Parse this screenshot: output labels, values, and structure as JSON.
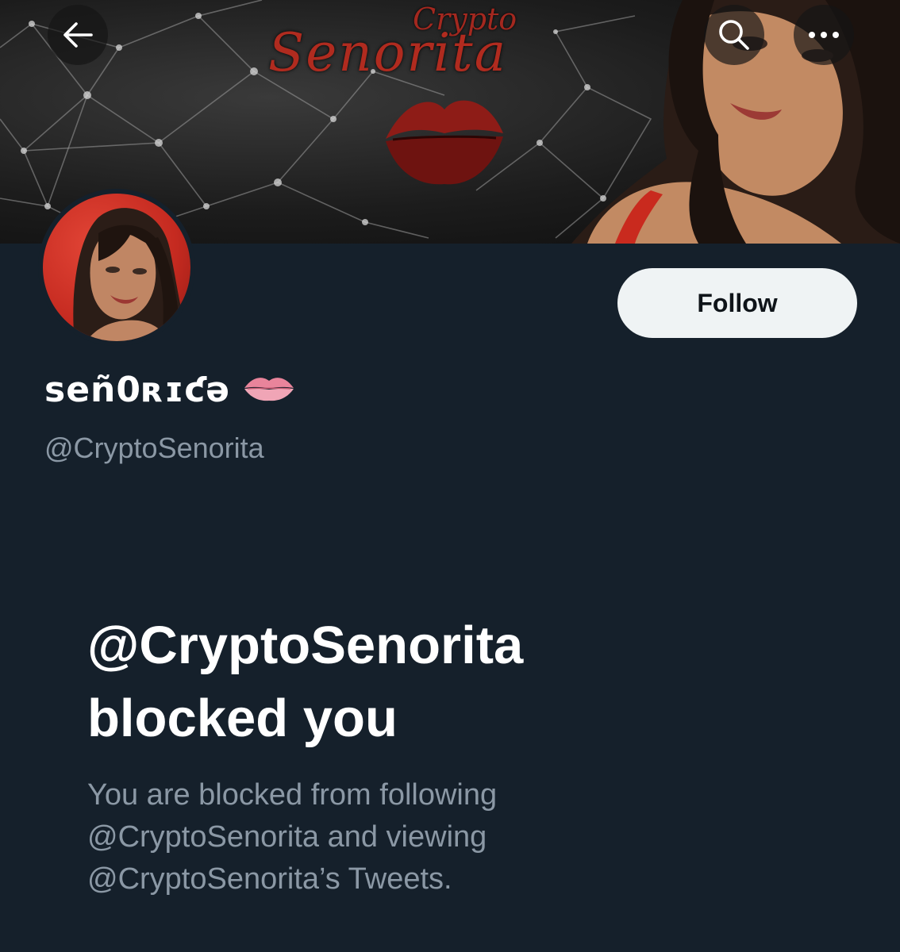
{
  "header": {
    "back_icon": "arrow-left-icon",
    "search_icon": "search-icon",
    "more_icon": "more-horizontal-icon"
  },
  "banner": {
    "logo_small": "Crypto",
    "logo_large": "Senorita"
  },
  "profile": {
    "display_name": "ѕеñ0ʀɪƈǝ",
    "display_name_emoji_icon": "lips-icon",
    "handle": "@CryptoSenorita",
    "follow_label": "Follow"
  },
  "blocked": {
    "title_line1": "@CryptoSenorita",
    "title_line2": "blocked you",
    "desc_line1": "You are blocked from following",
    "desc_line2": "@CryptoSenorita and viewing",
    "desc_line3": "@CryptoSenorita’s Tweets."
  },
  "colors": {
    "background": "#15202b",
    "primary_text": "#ffffff",
    "secondary_text": "#8b98a5",
    "follow_button_bg": "#eff3f4",
    "accent_red": "#b02b1f"
  }
}
